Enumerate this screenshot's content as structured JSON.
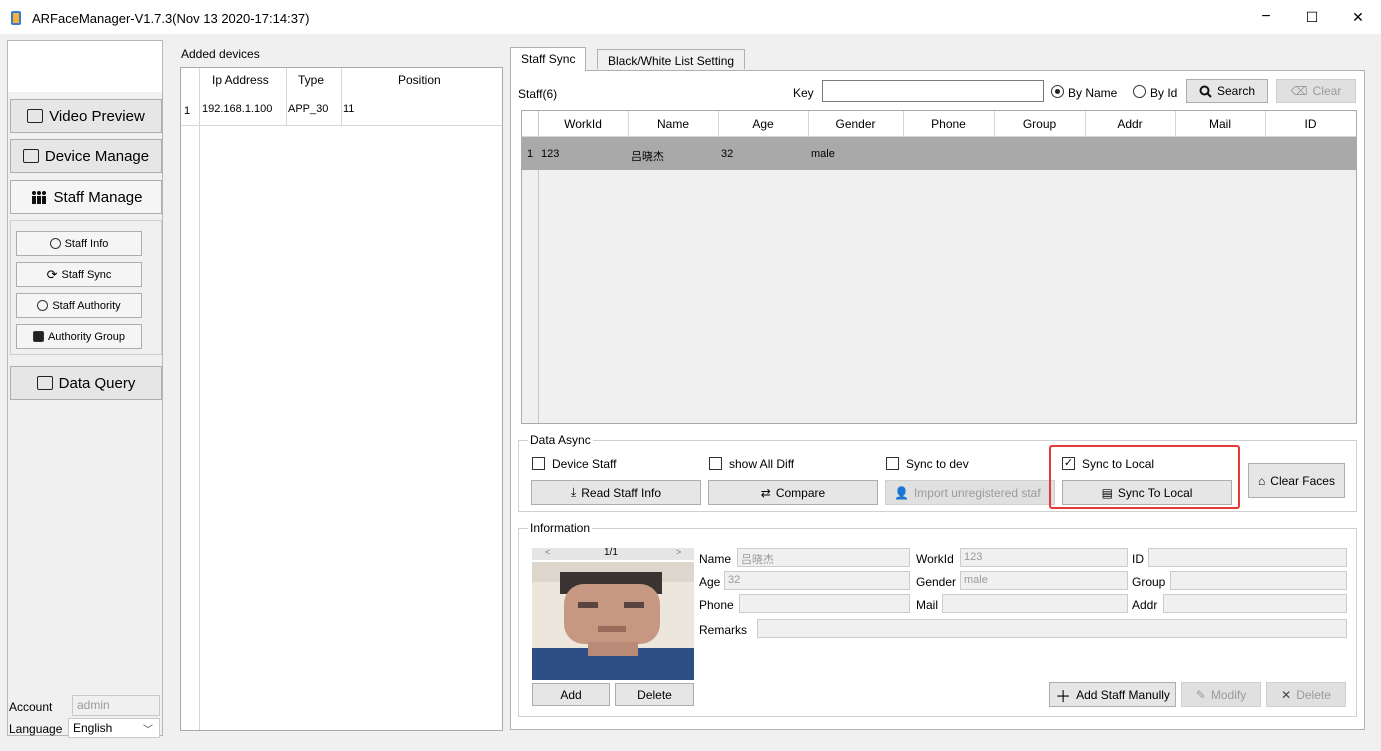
{
  "window": {
    "title": "ARFaceManager-V1.7.3(Nov 13 2020-17:14:37)",
    "minimize": "−",
    "maximize": "☐",
    "close": "✕"
  },
  "nav": {
    "video_preview": "Video Preview",
    "device_manage": "Device Manage",
    "staff_manage": "Staff Manage",
    "staff_info": "Staff Info",
    "staff_sync": "Staff Sync",
    "staff_authority": "Staff Authority",
    "authority_group": "Authority Group",
    "data_query": "Data Query"
  },
  "account": {
    "label": "Account",
    "value": "admin"
  },
  "language": {
    "label": "Language",
    "value": "English"
  },
  "devices": {
    "title": "Added devices",
    "columns": [
      "Ip Address",
      "Type",
      "Position"
    ],
    "rows": [
      {
        "num": "1",
        "ip": "192.168.1.100",
        "type": "APP_30",
        "position": "11"
      }
    ]
  },
  "tabs": {
    "staff_sync": "Staff Sync",
    "bw_list": "Black/White List Setting"
  },
  "search": {
    "staff_count": "Staff(6)",
    "key_label": "Key",
    "by_name": "By Name",
    "by_id": "By Id",
    "search": "Search",
    "clear": "Clear"
  },
  "staff_table": {
    "columns": [
      "WorkId",
      "Name",
      "Age",
      "Gender",
      "Phone",
      "Group",
      "Addr",
      "Mail",
      "ID"
    ],
    "rows": [
      {
        "num": "1",
        "workid": "123",
        "name": "吕晓杰",
        "age": "32",
        "gender": "male"
      }
    ]
  },
  "data_async": {
    "title": "Data Async",
    "device_staff": "Device Staff",
    "show_all_diff": "show All Diff",
    "sync_to_dev": "Sync to dev",
    "sync_to_local_cb": "Sync to Local",
    "read_staff_info": "Read Staff Info",
    "compare": "Compare",
    "import_unregistered": "Import unregistered staf",
    "sync_to_local_btn": "Sync To Local",
    "clear_faces": "Clear Faces",
    "sync_to_local_checked": true
  },
  "information": {
    "title": "Information",
    "page": "1/1",
    "prev": "<",
    "next": ">",
    "name_label": "Name",
    "name": "吕晓杰",
    "workid_label": "WorkId",
    "workid": "123",
    "id_label": "ID",
    "id": "",
    "age_label": "Age",
    "age": "32",
    "gender_label": "Gender",
    "gender": "male",
    "group_label": "Group",
    "group": "",
    "phone_label": "Phone",
    "phone": "",
    "mail_label": "Mail",
    "mail": "",
    "addr_label": "Addr",
    "addr": "",
    "remarks_label": "Remarks",
    "remarks": "",
    "add": "Add",
    "delete": "Delete",
    "add_staff_manually": "Add Staff Manully",
    "modify": "Modify",
    "delete_staff": "Delete"
  },
  "colors": {
    "highlight": "#e53935",
    "selected_row": "#a9a9a9"
  }
}
